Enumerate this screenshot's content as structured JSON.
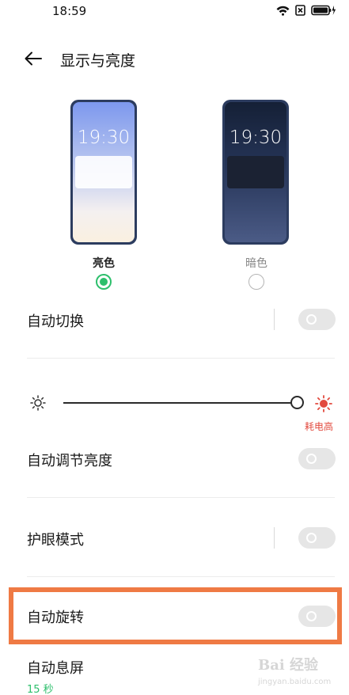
{
  "status_bar": {
    "time": "18:59",
    "icons": [
      "wifi-icon",
      "sim-off-icon",
      "battery-charging-icon"
    ]
  },
  "header": {
    "back_icon": "arrow-left-icon",
    "title": "显示与亮度"
  },
  "theme": {
    "light": {
      "clock": "19:30",
      "label": "亮色",
      "selected": true
    },
    "dark": {
      "clock": "19:30",
      "label": "暗色",
      "selected": false
    },
    "accent_color": "#2dbf6c"
  },
  "settings": {
    "auto_switch": {
      "label": "自动切换",
      "enabled": false
    },
    "brightness": {
      "level": 1.0,
      "note": "耗电高",
      "note_color": "#e24a3e"
    },
    "auto_brightness": {
      "label": "自动调节亮度",
      "enabled": false
    },
    "eye_care": {
      "label": "护眼模式",
      "enabled": false
    },
    "auto_rotate": {
      "label": "自动旋转",
      "enabled": false,
      "highlight_color": "#ef7a44"
    },
    "screen_timeout": {
      "label": "自动息屏",
      "value": "15 秒"
    }
  },
  "watermark": {
    "logo_text": "Bai 经验",
    "url": "jingyan.baidu.com"
  }
}
